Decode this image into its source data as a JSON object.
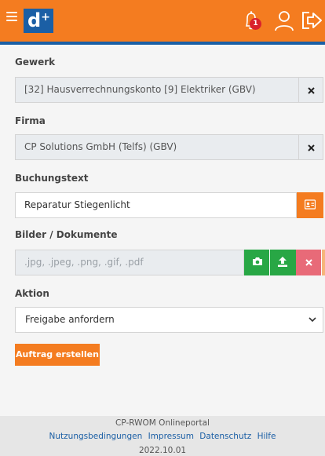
{
  "header": {
    "logo_text": "d",
    "logo_sup": "+",
    "notification_count": "1",
    "icons": [
      "menu-icon",
      "bell-icon",
      "user-icon",
      "logout-icon"
    ],
    "colors": {
      "bar": "#f47c20",
      "accent": "#1b5fa5"
    }
  },
  "form": {
    "gewerk": {
      "label": "Gewerk",
      "value": "[32] Hausverrechnungskonto [9] Elektriker (GBV)"
    },
    "firma": {
      "label": "Firma",
      "value": "CP Solutions GmbH  (Telfs) (GBV)"
    },
    "buchungstext": {
      "label": "Buchungstext",
      "value": "Reparatur Stiegenlicht"
    },
    "bilder": {
      "label": "Bilder / Dokumente",
      "placeholder": ".jpg, .jpeg, .png, .gif, .pdf"
    },
    "aktion": {
      "label": "Aktion",
      "selected": "Freigabe anfordern"
    },
    "submit_label": "Auftrag erstellen"
  },
  "footer": {
    "title": "CP-RWOM Onlineportal",
    "links": [
      "Nutzungsbedingungen",
      "Impressum",
      "Datenschutz",
      "Hilfe"
    ],
    "version": "2022.10.01"
  }
}
